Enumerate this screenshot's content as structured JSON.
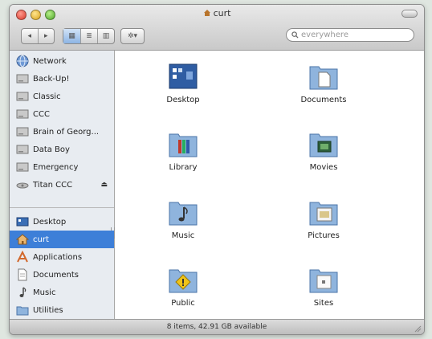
{
  "window": {
    "title": "curt"
  },
  "toolbar": {
    "back_label": "◂",
    "forward_label": "▸",
    "view_icon": "▦",
    "view_list": "≣",
    "view_column": "▥",
    "action_label": "✲▾",
    "search_placeholder": "everywhere"
  },
  "sidebar": {
    "devices": [
      {
        "label": "Network",
        "icon": "globe-icon"
      },
      {
        "label": "Back-Up!",
        "icon": "drive-icon"
      },
      {
        "label": "Classic",
        "icon": "drive-icon"
      },
      {
        "label": "CCC",
        "icon": "drive-icon"
      },
      {
        "label": "Brain of Georg...",
        "icon": "drive-icon"
      },
      {
        "label": "Data Boy",
        "icon": "drive-icon"
      },
      {
        "label": "Emergency",
        "icon": "drive-icon"
      },
      {
        "label": "Titan CCC",
        "icon": "disk-icon",
        "eject": "⏏"
      }
    ],
    "places": [
      {
        "label": "Desktop",
        "icon": "desktop-icon"
      },
      {
        "label": "curt",
        "icon": "home-icon",
        "selected": true
      },
      {
        "label": "Applications",
        "icon": "applications-icon"
      },
      {
        "label": "Documents",
        "icon": "document-icon"
      },
      {
        "label": "Music",
        "icon": "music-icon"
      },
      {
        "label": "Utilities",
        "icon": "folder-icon"
      }
    ]
  },
  "files": [
    {
      "label": "Desktop"
    },
    {
      "label": "Documents"
    },
    {
      "label": "Library"
    },
    {
      "label": "Movies"
    },
    {
      "label": "Music"
    },
    {
      "label": "Pictures"
    },
    {
      "label": "Public"
    },
    {
      "label": "Sites"
    }
  ],
  "status": {
    "text": "8 items, 42.91 GB available"
  },
  "colors": {
    "selection": "#3d7fd8",
    "folder_blue": "#8fb4dd"
  }
}
